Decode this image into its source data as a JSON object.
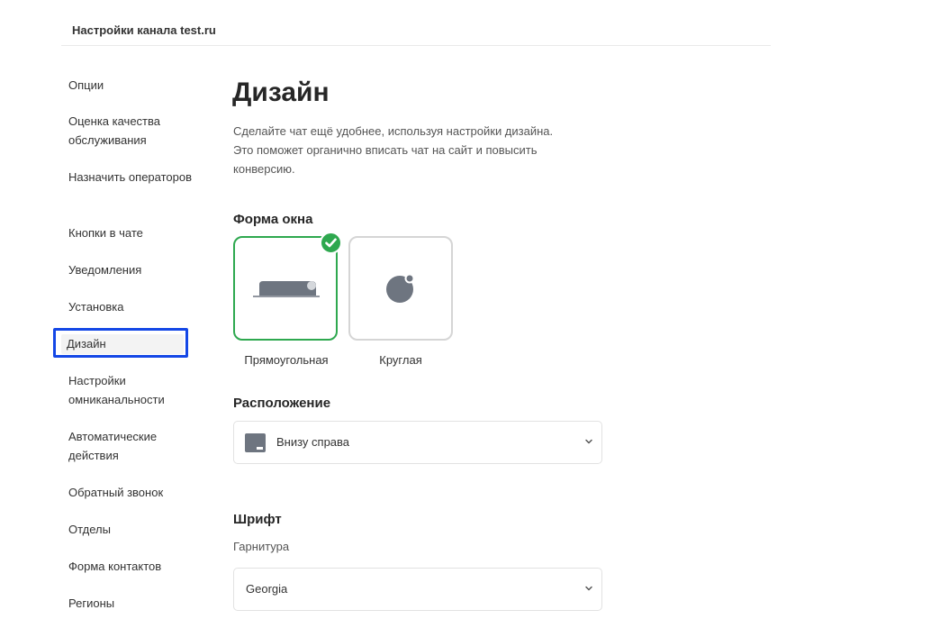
{
  "header": {
    "title": "Настройки канала test.ru"
  },
  "sidebar": {
    "items": [
      {
        "label": "Опции"
      },
      {
        "label": "Оценка качества обслуживания"
      },
      {
        "label": "Назначить операторов"
      },
      {
        "label": "Кнопки в чате"
      },
      {
        "label": "Уведомления"
      },
      {
        "label": "Установка"
      },
      {
        "label": "Дизайн",
        "active": true
      },
      {
        "label": "Настройки омниканальности"
      },
      {
        "label": "Автоматические действия"
      },
      {
        "label": "Обратный звонок"
      },
      {
        "label": "Отделы"
      },
      {
        "label": "Форма контактов"
      },
      {
        "label": "Регионы"
      }
    ]
  },
  "main": {
    "title": "Дизайн",
    "description_lines": [
      "Сделайте чат ещё удобнее, используя настройки дизайна.",
      "Это поможет органично вписать чат на сайт и повысить",
      "конверсию."
    ],
    "window_shape": {
      "title": "Форма окна",
      "options": [
        {
          "label": "Прямоугольная",
          "selected": true,
          "icon": "rectangle-window-icon"
        },
        {
          "label": "Круглая",
          "selected": false,
          "icon": "round-window-icon"
        }
      ]
    },
    "position": {
      "title": "Расположение",
      "value": "Внизу справа",
      "icon": "bottom-right-position-icon"
    },
    "font": {
      "title": "Шрифт",
      "typeface_label": "Гарнитура",
      "value": "Georgia"
    }
  },
  "colors": {
    "accent_green": "#2ea84f",
    "highlight_blue": "#1447e6",
    "icon_gray": "#6e7580"
  }
}
